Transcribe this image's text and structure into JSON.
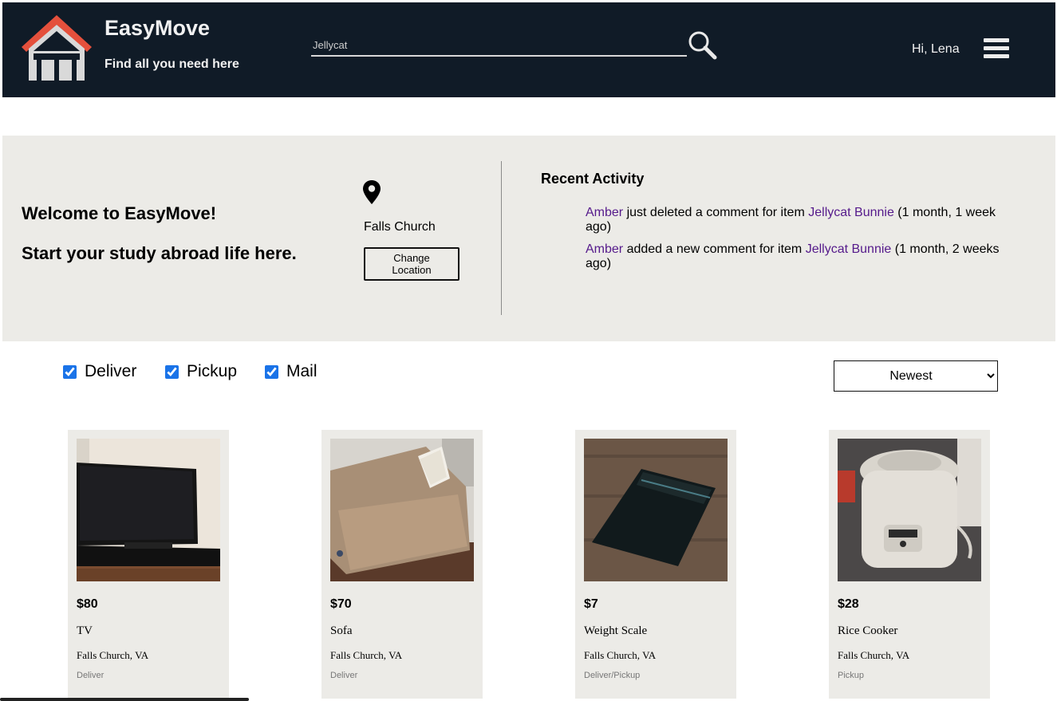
{
  "header": {
    "brand_title": "EasyMove",
    "brand_tagline": "Find all you need here",
    "search_value": "Jellycat",
    "greeting": "Hi, Lena",
    "background_color": "#101b27",
    "roof_color": "#e4503c"
  },
  "banner": {
    "welcome_line1": "Welcome to EasyMove!",
    "welcome_line2": "Start your study abroad life here.",
    "location": "Falls Church",
    "change_location_label": "Change Location",
    "recent_activity_title": "Recent Activity",
    "activity": [
      {
        "user": "Amber",
        "action": " just deleted a comment for item ",
        "item": "Jellycat Bunnie",
        "time": " (1 month, 1 week ago)"
      },
      {
        "user": "Amber",
        "action": " added a new comment for item ",
        "item": "Jellycat Bunnie",
        "time": " (1 month, 2 weeks ago)"
      }
    ]
  },
  "filters": {
    "deliver": "Deliver",
    "pickup": "Pickup",
    "mail": "Mail",
    "sort_selected": "Newest"
  },
  "products": [
    {
      "price": "$80",
      "name": "TV",
      "location": "Falls Church, VA",
      "method": "Deliver"
    },
    {
      "price": "$70",
      "name": "Sofa",
      "location": "Falls Church, VA",
      "method": "Deliver"
    },
    {
      "price": "$7",
      "name": "Weight Scale",
      "location": "Falls Church, VA",
      "method": "Deliver/Pickup"
    },
    {
      "price": "$28",
      "name": "Rice Cooker",
      "location": "Falls Church, VA",
      "method": "Pickup"
    }
  ]
}
